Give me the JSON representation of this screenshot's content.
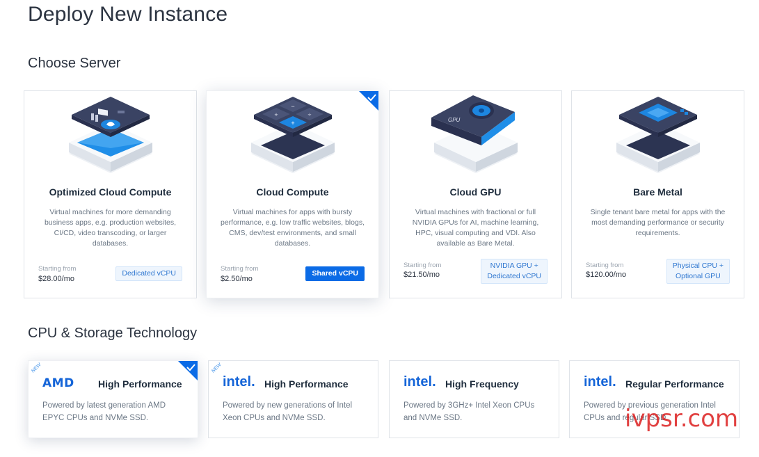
{
  "page": {
    "title": "Deploy New Instance"
  },
  "sections": {
    "server": "Choose Server",
    "tech": "CPU & Storage Technology"
  },
  "colors": {
    "accent": "#0b6be6",
    "tag_bg": "#eef5fd",
    "tag_text": "#2f77d0"
  },
  "servers": [
    {
      "name": "Optimized Cloud Compute",
      "desc": "Virtual machines for more demanding business apps, e.g. production websites, CI/CD, video transcoding, or larger databases.",
      "price_label": "Starting from",
      "price": "$28.00/mo",
      "tag": "Dedicated vCPU",
      "selected": false
    },
    {
      "name": "Cloud Compute",
      "desc": "Virtual machines for apps with bursty performance, e.g. low traffic websites, blogs, CMS, dev/test environments, and small databases.",
      "price_label": "Starting from",
      "price": "$2.50/mo",
      "tag": "Shared vCPU",
      "selected": true
    },
    {
      "name": "Cloud GPU",
      "desc": "Virtual machines with fractional or full NVIDIA GPUs for AI, machine learning, HPC, visual computing and VDI. Also available as Bare Metal.",
      "price_label": "Starting from",
      "price": "$21.50/mo",
      "tag_line1": "NVIDIA GPU +",
      "tag_line2": "Dedicated vCPU",
      "selected": false
    },
    {
      "name": "Bare Metal",
      "desc": "Single tenant bare metal for apps with the most demanding performance or security requirements.",
      "price_label": "Starting from",
      "price": "$120.00/mo",
      "tag_line1": "Physical CPU +",
      "tag_line2": "Optional GPU",
      "selected": false
    }
  ],
  "gpu_chip_label": "GPU",
  "tech": [
    {
      "brand": "AMD",
      "name": "High Performance",
      "desc": "Powered by latest generation AMD EPYC CPUs and NVMe SSD.",
      "badge": "NEW",
      "selected": true
    },
    {
      "brand": "intel.",
      "name": "High Performance",
      "desc": "Powered by new generations of Intel Xeon CPUs and NVMe SSD.",
      "badge": "NEW",
      "selected": false
    },
    {
      "brand": "intel.",
      "name": "High Frequency",
      "desc": "Powered by 3GHz+ Intel Xeon CPUs and NVMe SSD.",
      "selected": false
    },
    {
      "brand": "intel.",
      "name": "Regular Performance",
      "desc": "Powered by previous generation Intel CPUs and regular SSD.",
      "selected": false
    }
  ],
  "watermark": "ivpsr.com"
}
